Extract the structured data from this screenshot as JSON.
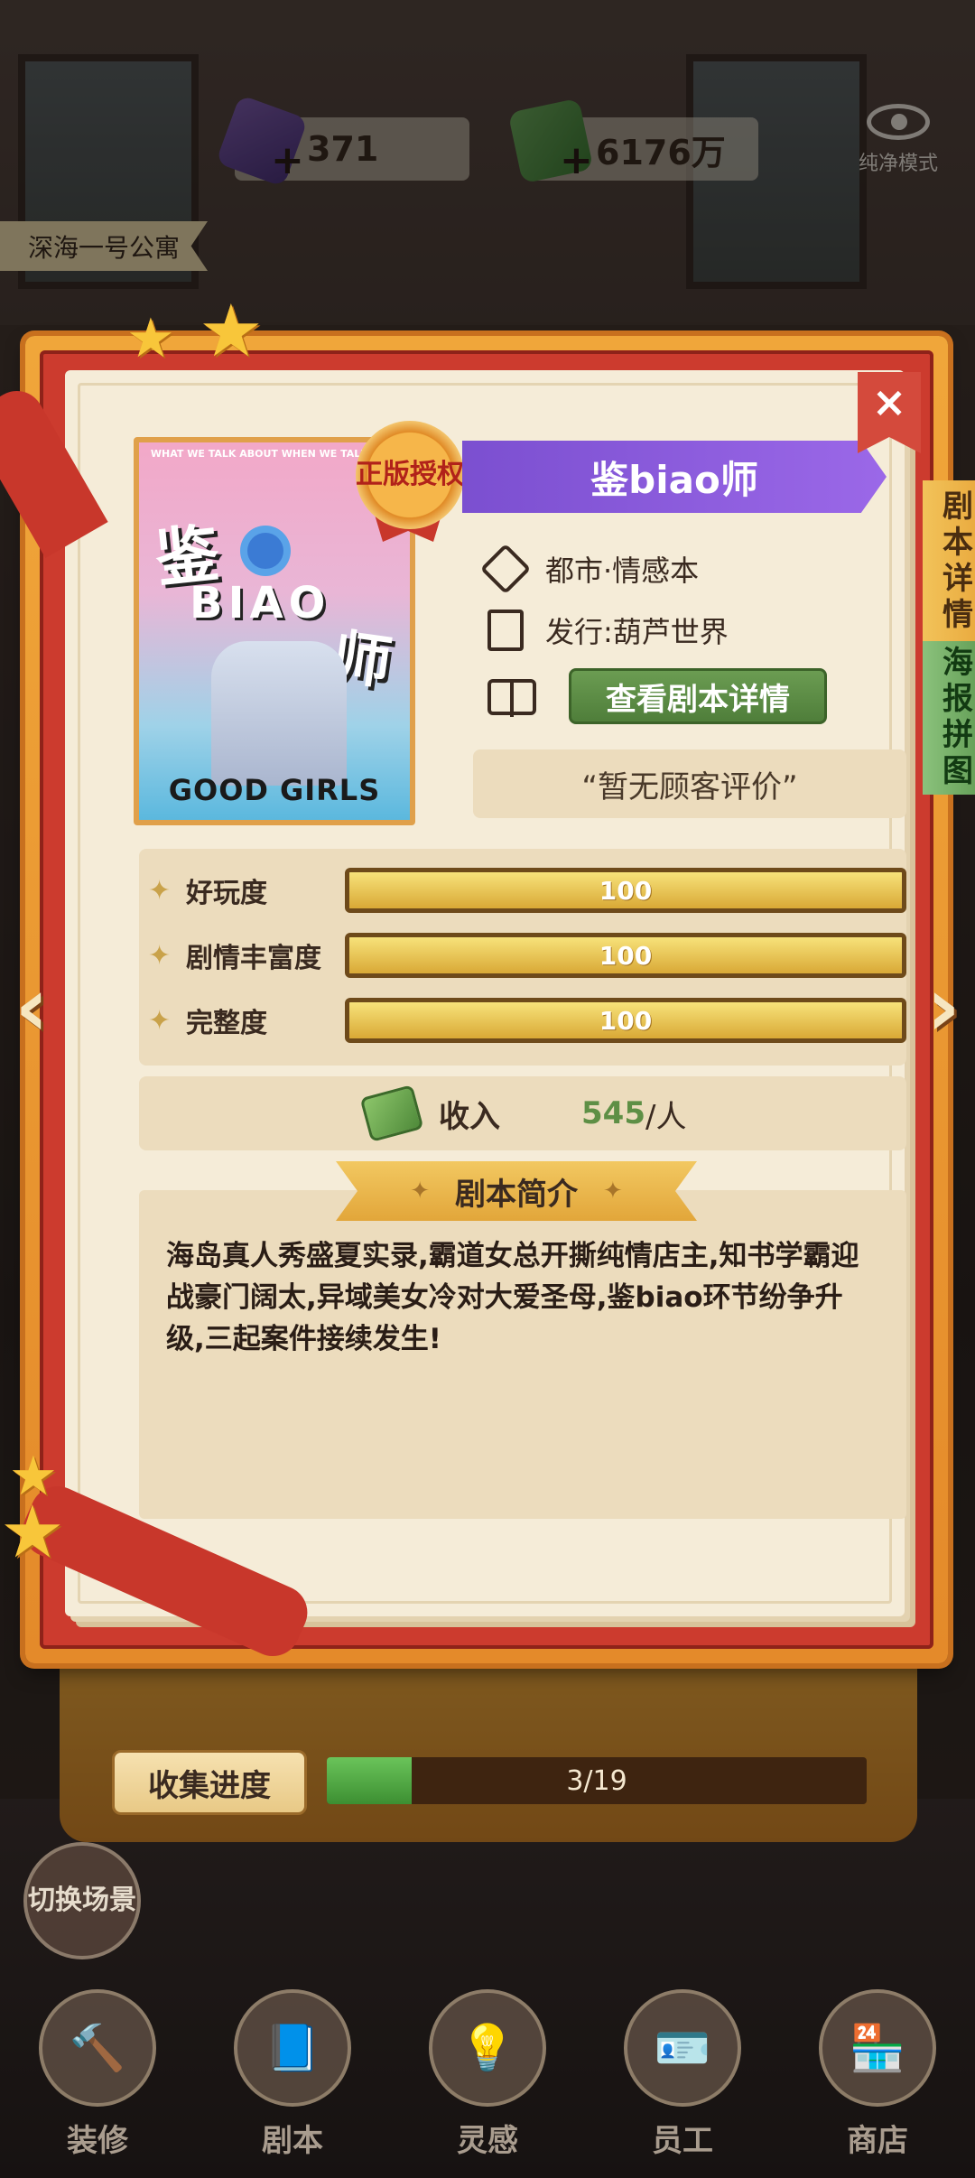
{
  "resources": {
    "gems": "371",
    "cash": "6176万",
    "pure_mode_label": "纯净模式",
    "location": "深海一号公寓"
  },
  "script": {
    "title": "鉴biao师",
    "badge": "正版授权",
    "genre": "都市·情感本",
    "publisher": "发行:葫芦世界",
    "detail_button": "查看剧本详情",
    "review": "“暂无顾客评价”",
    "poster": {
      "top_text": "WHAT WE TALK ABOUT WHEN WE TALK AB...",
      "title_1": "鉴",
      "title_2": "BIAO",
      "title_3": "师",
      "footer_left": "GOOD",
      "footer_right": "GIRLS"
    }
  },
  "side_tabs": {
    "detail": "剧本详情",
    "poster": "海报拼图"
  },
  "ratings": [
    {
      "label": "好玩度",
      "value": "100",
      "fill": 1.0
    },
    {
      "label": "剧情丰富度",
      "value": "100",
      "fill": 1.0
    },
    {
      "label": "完整度",
      "value": "100",
      "fill": 1.0
    }
  ],
  "income": {
    "label": "收入",
    "value": "545",
    "unit": "/人"
  },
  "synopsis": {
    "header": "剧本简介",
    "text": "海岛真人秀盛夏实录,霸道女总开撕纯情店主,知书学霸迎战豪门阔太,异域美女冷对大爱圣母,鉴biao环节纷争升级,三起案件接续发生!"
  },
  "collection": {
    "button": "收集进度",
    "progress_text": "3/19",
    "fraction": 0.158
  },
  "switch_scene": "切换场景",
  "bottom_nav": [
    {
      "label": "装修",
      "icon": "hammer-icon"
    },
    {
      "label": "剧本",
      "icon": "book-icon"
    },
    {
      "label": "灵感",
      "icon": "bulb-icon"
    },
    {
      "label": "员工",
      "icon": "id-card-icon"
    },
    {
      "label": "商店",
      "icon": "shop-icon"
    }
  ],
  "colors": {
    "frame_orange": "#f0a63a",
    "frame_red": "#cc3b2e",
    "paper": "#f5ecd8",
    "title_purple": "#8a5ddc",
    "button_green": "#5f8f46",
    "income_green": "#5e8f45"
  }
}
